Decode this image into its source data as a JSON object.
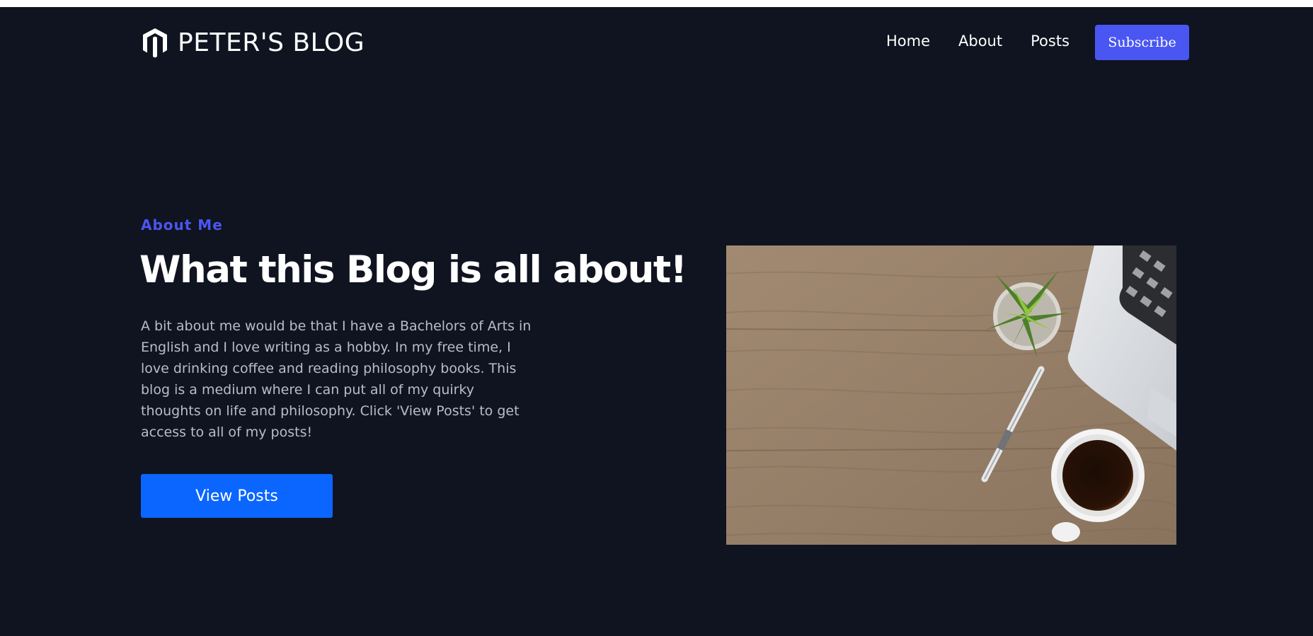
{
  "header": {
    "brand_name": "PETER'S BLOG",
    "logo_icon": "shield-m-logo-icon",
    "nav": [
      {
        "label": "Home"
      },
      {
        "label": "About"
      },
      {
        "label": "Posts"
      }
    ],
    "subscribe_label": "Subscribe"
  },
  "hero": {
    "eyebrow": "About Me",
    "title": "What this Blog is all about!",
    "body": "A bit about me would be that I have a Bachelors of Arts in English and I love writing as a hobby. In my free time, I love drinking coffee and reading philosophy books. This blog is a medium where I can put all of my quirky thoughts on life and philosophy. Click 'View Posts' to get access to all of my posts!",
    "cta_label": "View Posts",
    "image_subject": "desk-scene-with-laptop-plant-pen-coffee"
  },
  "colors": {
    "background": "#0f1420",
    "accent_indigo": "#4a56f2",
    "cta_blue": "#0a66ff",
    "body_text": "#b7bdc9"
  }
}
